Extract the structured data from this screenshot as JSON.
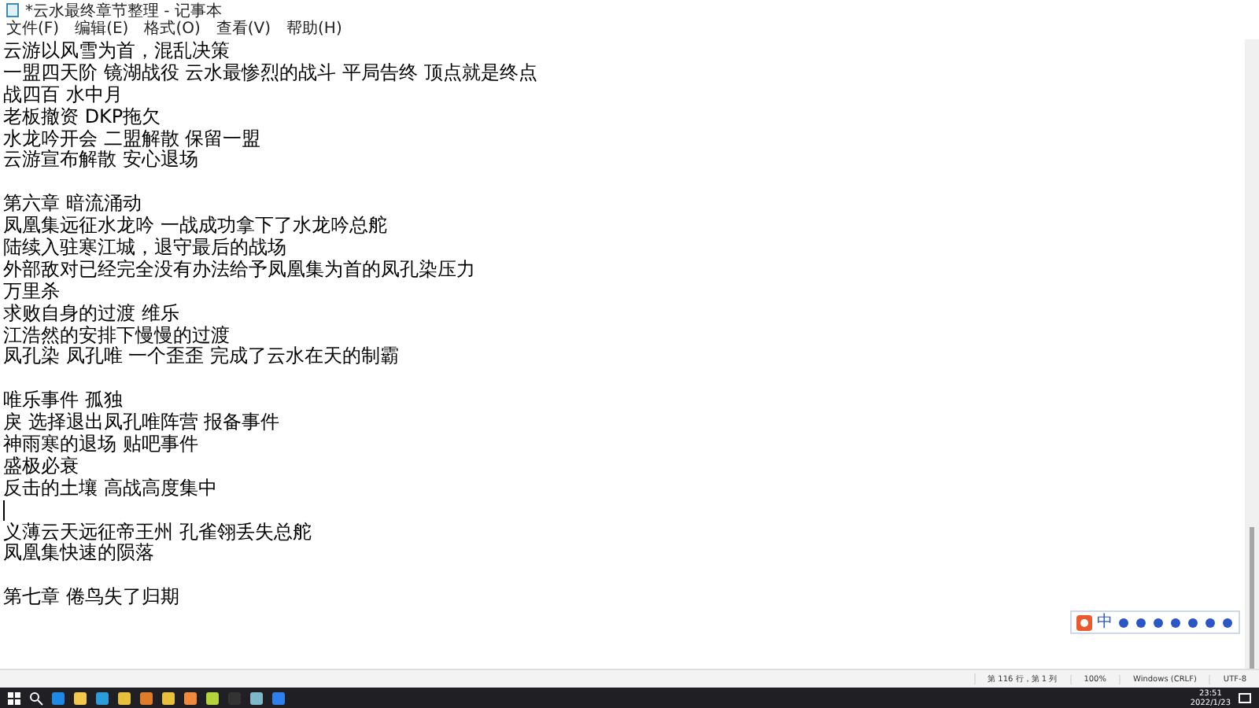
{
  "window": {
    "title": "*云水最终章节整理 - 记事本"
  },
  "menu": [
    "文件(F)",
    "编辑(E)",
    "格式(O)",
    "查看(V)",
    "帮助(H)"
  ],
  "lines": [
    {
      "kind": "text",
      "text": "云游以风雪为首，混乱决策"
    },
    {
      "kind": "text",
      "text": "一盟四天阶 镜湖战役 云水最惨烈的战斗 平局告终 顶点就是终点"
    },
    {
      "kind": "text",
      "text": "战四百 水中月"
    },
    {
      "kind": "text",
      "text": "老板撤资 DKP拖欠"
    },
    {
      "kind": "text",
      "text": "水龙吟开会 二盟解散 保留一盟"
    },
    {
      "kind": "text",
      "text": "云游宣布解散 安心退场"
    },
    {
      "kind": "blank"
    },
    {
      "kind": "text",
      "text": "第六章 暗流涌动"
    },
    {
      "kind": "text",
      "text": "凤凰集远征水龙吟 一战成功拿下了水龙吟总舵"
    },
    {
      "kind": "text",
      "text": "陆续入驻寒江城，退守最后的战场"
    },
    {
      "kind": "text",
      "text": "外部敌对已经完全没有办法给予凤凰集为首的凤孔染压力"
    },
    {
      "kind": "text",
      "text": "万里杀"
    },
    {
      "kind": "text",
      "text": "求败自身的过渡 维乐"
    },
    {
      "kind": "text",
      "text": "江浩然的安排下慢慢的过渡"
    },
    {
      "kind": "text",
      "text": "凤孔染 凤孔唯 一个歪歪 完成了云水在天的制霸"
    },
    {
      "kind": "blank"
    },
    {
      "kind": "text",
      "text": "唯乐事件 孤独"
    },
    {
      "kind": "text",
      "text": "戾 选择退出凤孔唯阵营 报备事件"
    },
    {
      "kind": "text",
      "text": "神雨寒的退场 贴吧事件"
    },
    {
      "kind": "text",
      "text": "盛极必衰"
    },
    {
      "kind": "text",
      "text": "反击的土壤 高战高度集中"
    },
    {
      "kind": "cursor"
    },
    {
      "kind": "text",
      "text": "义薄云天远征帝王州 孔雀翎丢失总舵"
    },
    {
      "kind": "text",
      "text": "凤凰集快速的陨落"
    },
    {
      "kind": "blank"
    },
    {
      "kind": "text",
      "text": "第七章 倦鸟失了归期"
    }
  ],
  "ime": {
    "label": "中"
  },
  "status_bar": {
    "position": "第 116 行，第 1 列",
    "zoom": "100%",
    "line_ending": "Windows (CRLF)",
    "encoding": "UTF-8"
  },
  "taskbar": {
    "time": "23:51",
    "date": "2022/1/23"
  }
}
